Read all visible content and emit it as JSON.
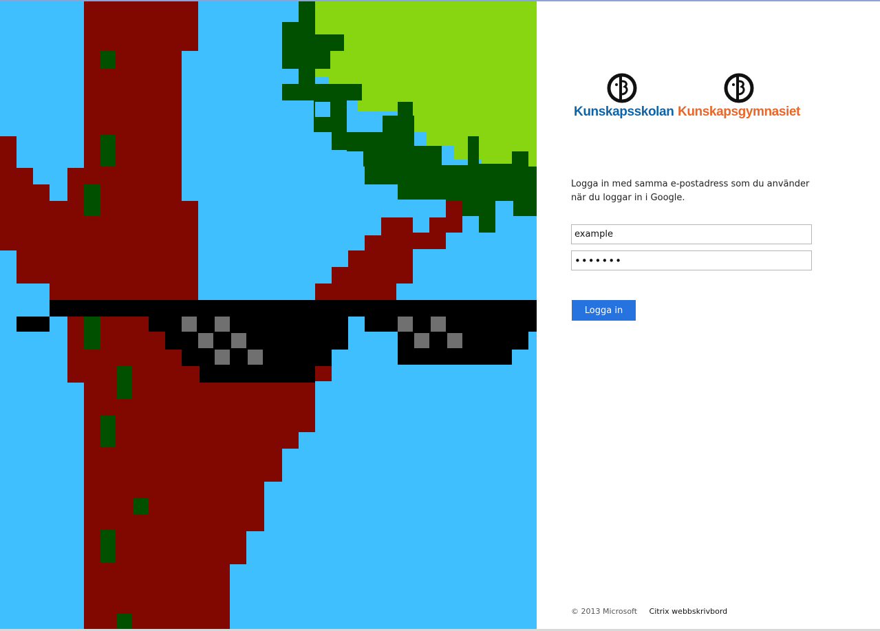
{
  "brand": {
    "school_name": "Kunskapsskolan",
    "gymnasium_name": "Kunskapsgymnasiet",
    "school_color": "#0e64a8",
    "gymnasium_color": "#e8672a"
  },
  "login": {
    "instructions": "Logga in med samma e-postadress som du använder när du loggar in i Google.",
    "username_value": "example",
    "password_value": "•••••••",
    "submit_label": "Logga in",
    "accent_color": "#2673df"
  },
  "footer": {
    "copyright": "© 2013 Microsoft",
    "product_link": "Citrix webbskrivbord"
  },
  "artwork": {
    "colors": {
      "sky": "#40bfff",
      "trunk": "#800800",
      "leaves_dark": "#005000",
      "leaves_light": "#88d612",
      "glasses": "#000000",
      "lens_pixel": "#707070"
    }
  }
}
